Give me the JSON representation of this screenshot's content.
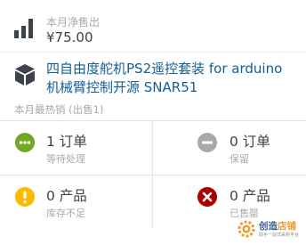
{
  "sales": {
    "icon": "bar-chart-icon",
    "label": "本月净售出",
    "value": "¥75.00"
  },
  "top_seller": {
    "icon": "box-icon",
    "product_line1": "四自由度舵机PS2遥控套装 for arduino",
    "product_line2": "机械臂控制开源 SNAR51",
    "label": "本月最热销 (出售1)"
  },
  "status_cells": [
    {
      "icon": "ellipsis-icon",
      "color": "#73a724",
      "value": "1 订单",
      "label": "等待处理"
    },
    {
      "icon": "minus-icon",
      "color": "#a7aaad",
      "value": "0 订单",
      "label": "保留"
    },
    {
      "icon": "exclamation-icon",
      "color": "#ffba00",
      "value": "0 产品",
      "label": "库存不足"
    },
    {
      "icon": "x-icon",
      "color": "#aa0000",
      "value": "0 产品",
      "label": "已售罄"
    }
  ],
  "watermark": {
    "logo": "gear-logo-icon",
    "brand_a": "创造",
    "brand_b": "店铺",
    "tagline": "助手一站式采购平台"
  }
}
